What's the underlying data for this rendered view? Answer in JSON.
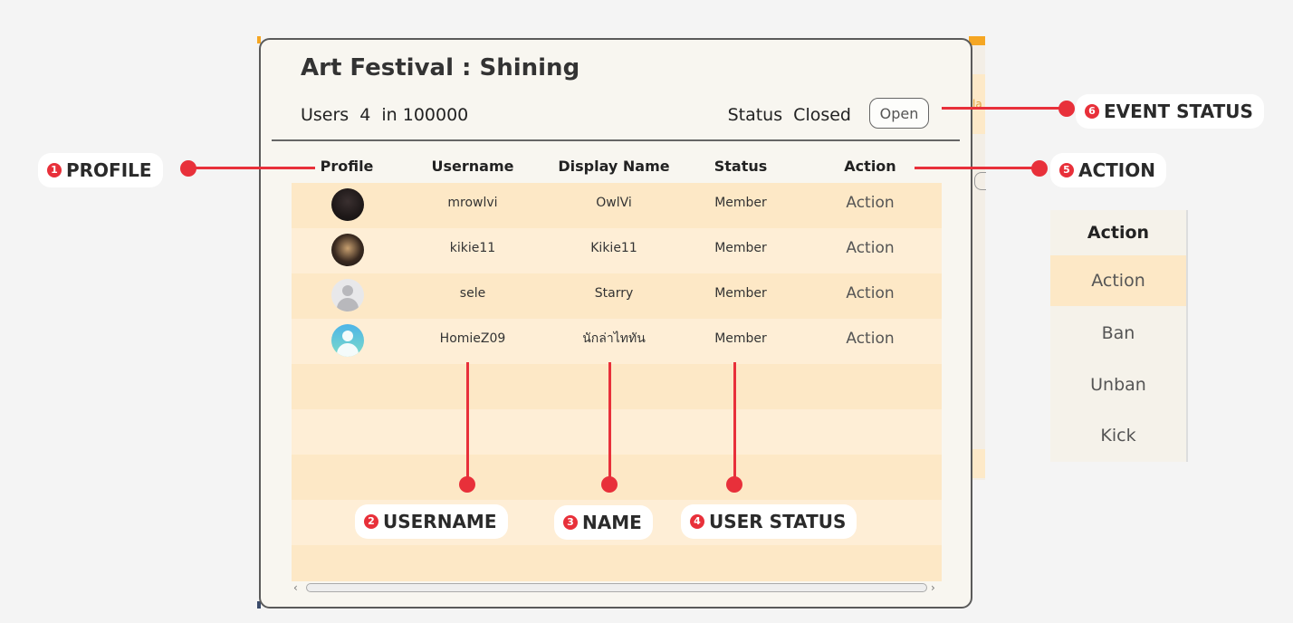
{
  "panel": {
    "title": "Art Festival : Shining",
    "users_label": "Users",
    "users_count": "4",
    "users_in": "in",
    "users_capacity": "100000",
    "status_label": "Status",
    "status_value": "Closed",
    "open_button": "Open"
  },
  "table": {
    "headers": [
      "Profile",
      "Username",
      "Display Name",
      "Status",
      "Action"
    ],
    "rows": [
      {
        "username": "mrowlvi",
        "display_name": "OwlVi",
        "status": "Member",
        "action": "Action",
        "avatar": "dark-photo-avatar"
      },
      {
        "username": "kikie11",
        "display_name": "Kikie11",
        "status": "Member",
        "action": "Action",
        "avatar": "anime-photo-avatar"
      },
      {
        "username": "sele",
        "display_name": "Starry",
        "status": "Member",
        "action": "Action",
        "avatar": "default-gray-avatar"
      },
      {
        "username": "HomieZ09",
        "display_name": "นักล่าไททัน",
        "status": "Member",
        "action": "Action",
        "avatar": "default-gradient-avatar"
      }
    ]
  },
  "annotations": {
    "profile": {
      "num": "1",
      "label": "PROFILE"
    },
    "username": {
      "num": "2",
      "label": "USERNAME"
    },
    "name": {
      "num": "3",
      "label": "NAME"
    },
    "user_status": {
      "num": "4",
      "label": "USER STATUS"
    },
    "action": {
      "num": "5",
      "label": "ACTION"
    },
    "event_status": {
      "num": "6",
      "label": "EVENT STATUS"
    }
  },
  "action_menu": {
    "header": "Action",
    "items": [
      "Action",
      "Ban",
      "Unban",
      "Kick"
    ]
  },
  "background_window": {
    "partial_label": "la"
  },
  "colors": {
    "accent": "#e8303a",
    "row_fill": "#fde8c6",
    "row_alt_fill": "#feeed6",
    "panel_bg": "#f8f6f0"
  }
}
